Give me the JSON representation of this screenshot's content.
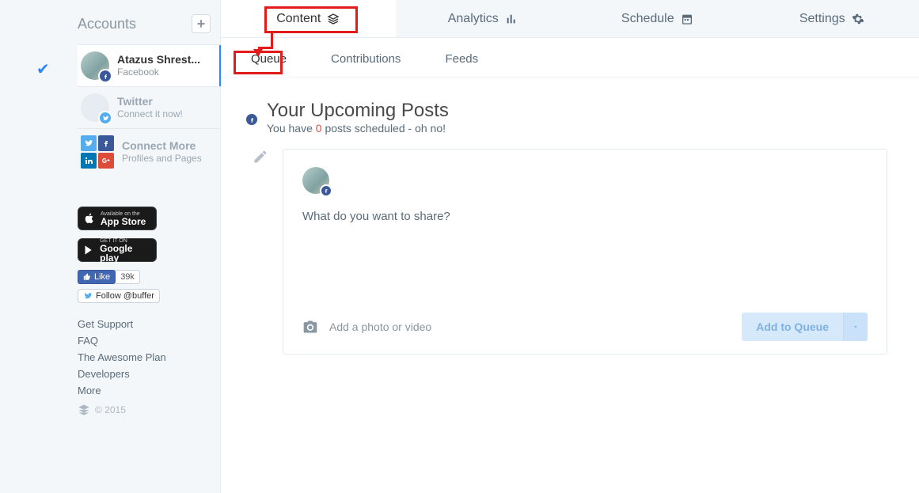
{
  "sidebar": {
    "title": "Accounts",
    "add_tooltip": "+",
    "accounts": [
      {
        "name": "Atazus Shrest...",
        "sub": "Facebook",
        "network": "facebook",
        "selected": true
      },
      {
        "name": "Twitter",
        "sub": "Connect it now!",
        "network": "twitter",
        "selected": false
      },
      {
        "name": "Connect More",
        "sub": "Profiles and Pages",
        "network": "more",
        "selected": false
      }
    ],
    "appstore_top": "Available on the",
    "appstore_bottom": "App Store",
    "play_top": "GET IT ON",
    "play_bottom": "Google play",
    "fb_like_label": "Like",
    "fb_like_count": "39k",
    "tw_follow_label": "Follow @buffer",
    "links": [
      "Get Support",
      "FAQ",
      "The Awesome Plan",
      "Developers",
      "More"
    ],
    "copyright": "© 2015"
  },
  "topnav": {
    "tabs": [
      {
        "label": "Content",
        "icon": "stack",
        "active": true
      },
      {
        "label": "Analytics",
        "icon": "bars",
        "active": false
      },
      {
        "label": "Schedule",
        "icon": "calendar",
        "active": false
      },
      {
        "label": "Settings",
        "icon": "gear",
        "active": false
      }
    ]
  },
  "subnav": {
    "items": [
      {
        "label": "Queue",
        "active": true
      },
      {
        "label": "Contributions",
        "active": false
      },
      {
        "label": "Feeds",
        "active": false
      }
    ]
  },
  "queue": {
    "title": "Your Upcoming Posts",
    "sub_pre": "You have ",
    "count": "0",
    "sub_post": " posts scheduled - oh no!",
    "compose_prompt": "What do you want to share?",
    "media_label": "Add a photo or video",
    "add_button": "Add to Queue"
  },
  "annotations": {
    "highlights": [
      "topnav.Content",
      "subnav.Queue"
    ],
    "arrow_from": "topnav.Content",
    "arrow_to": "subnav.Queue"
  }
}
